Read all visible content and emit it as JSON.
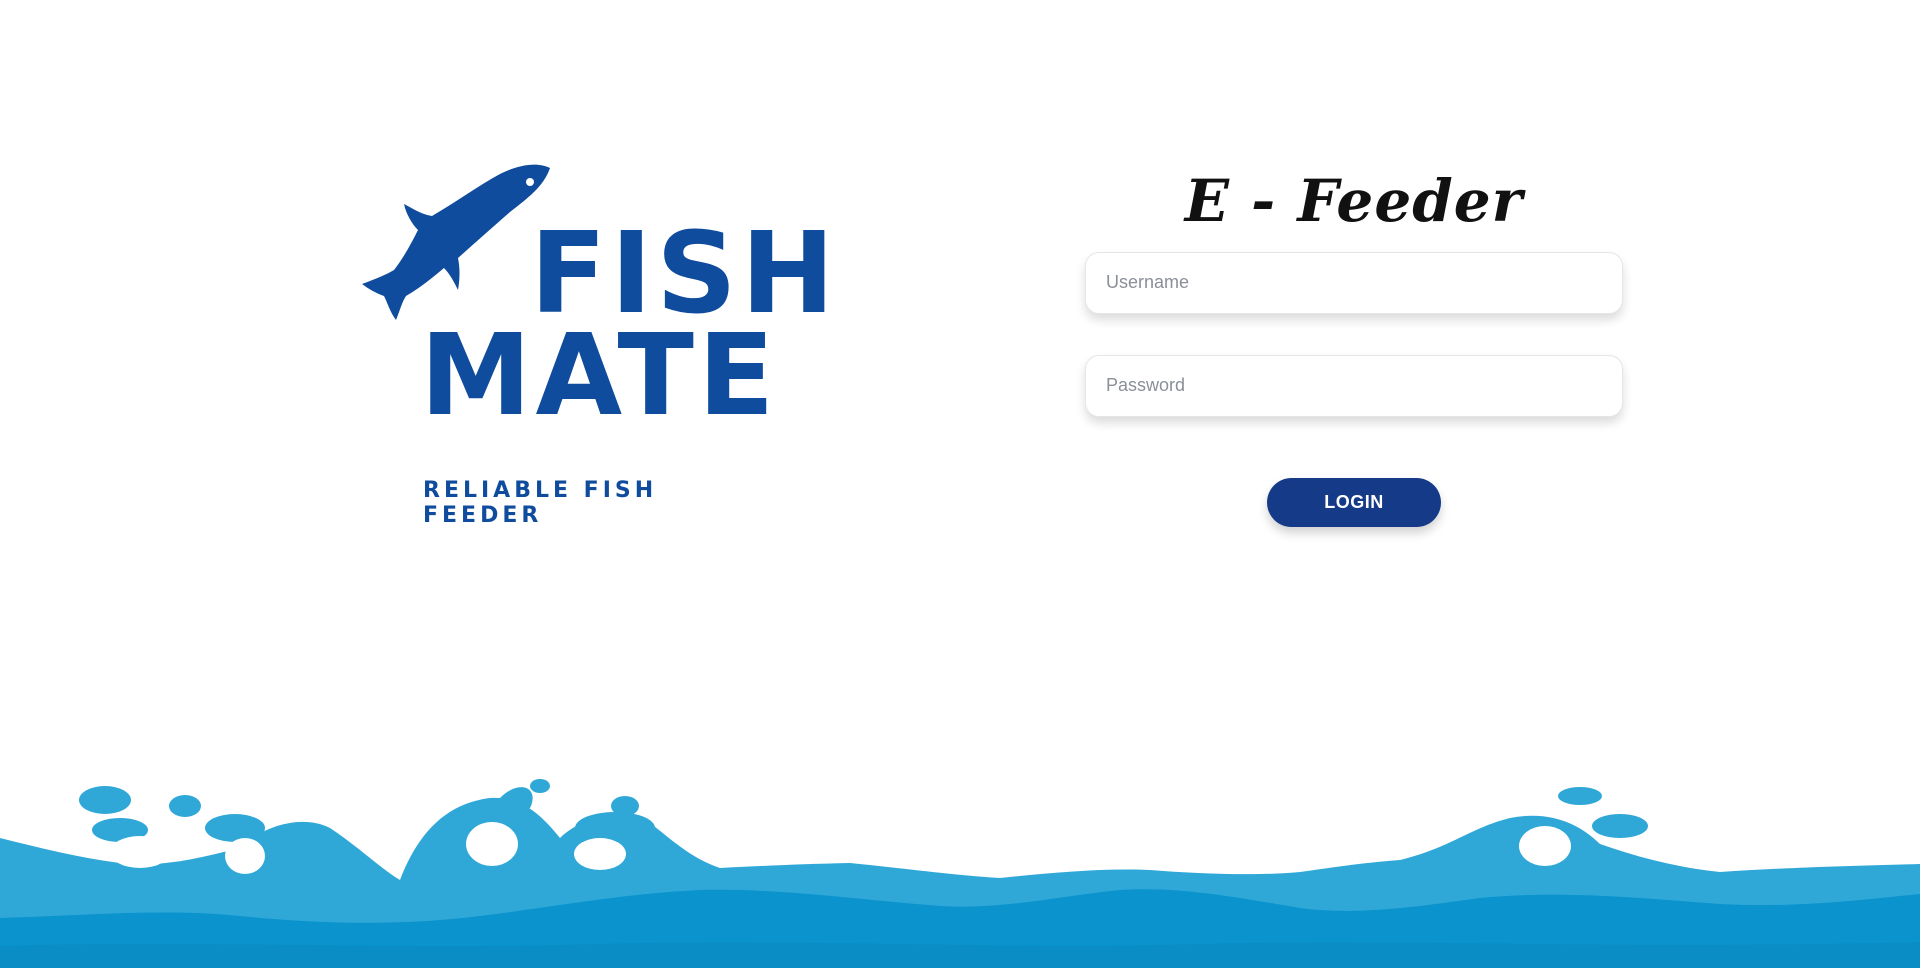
{
  "brand": {
    "logo_line1": "FISH",
    "logo_line2": "MATE",
    "tagline": "RELIABLE FISH FEEDER",
    "logo_icon": "fish-icon",
    "color": "#0f4c9d"
  },
  "login": {
    "title": "E - Feeder",
    "username_placeholder": "Username",
    "password_placeholder": "Password",
    "submit_label": "LOGIN",
    "button_color": "#153a87"
  },
  "decoration": {
    "footer": "ocean-waves",
    "wave_color_light": "#2fa8d8",
    "wave_color_dark": "#0a93cc"
  }
}
